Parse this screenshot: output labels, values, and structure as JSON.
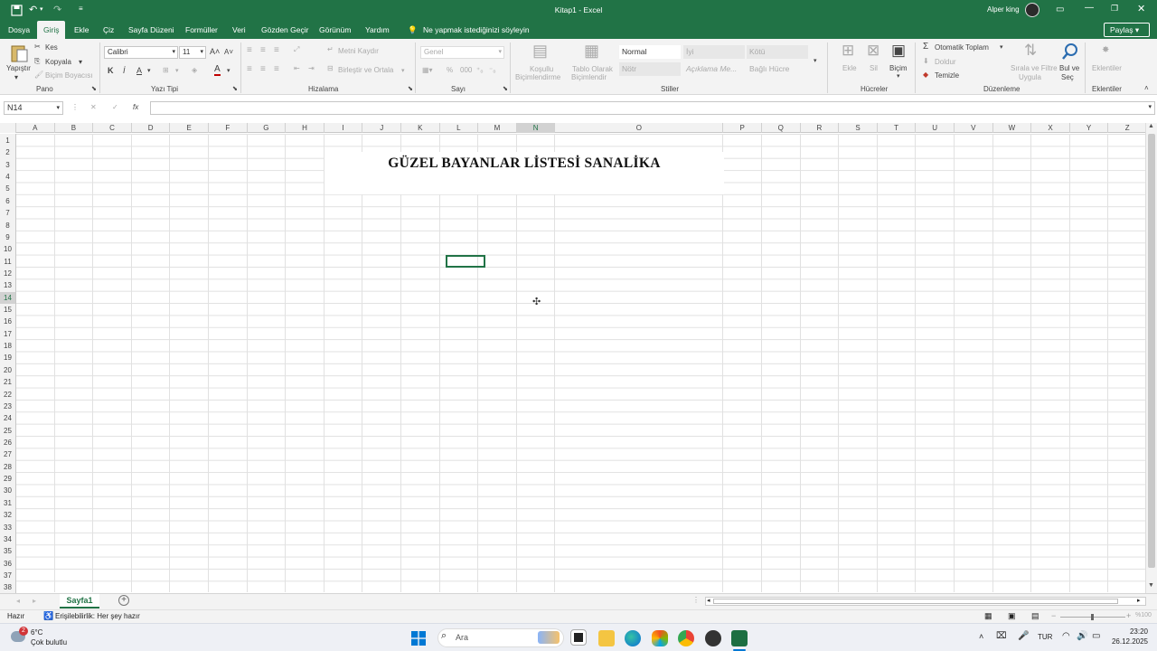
{
  "title_bar": {
    "doc_title": "Kitap1 - Excel",
    "user_name": "Alper king"
  },
  "ribbon_tabs": [
    "Dosya",
    "Giriş",
    "Ekle",
    "Çiz",
    "Sayfa Düzeni",
    "Formüller",
    "Veri",
    "Gözden Geçir",
    "Görünüm",
    "Yardım"
  ],
  "tell_me": "Ne yapmak istediğinizi söyleyin",
  "share_label": "Paylaş",
  "clipboard": {
    "paste": "Yapıştır",
    "cut": "Kes",
    "copy": "Kopyala",
    "format_painter": "Biçim Boyacısı",
    "group": "Pano"
  },
  "font": {
    "name": "Calibri",
    "size": "11",
    "bold": "K",
    "italic": "İ",
    "underline": "A",
    "color_btn": "A",
    "group": "Yazı Tipi"
  },
  "alignment": {
    "wrap": "Metni Kaydır",
    "merge": "Birleştir ve Ortala",
    "group": "Hizalama"
  },
  "number": {
    "format": "Genel",
    "percent": "%",
    "group": "Sayı"
  },
  "styles": {
    "conditional": [
      "Koşullu",
      "Biçimlendirme"
    ],
    "table": [
      "Tablo Olarak",
      "Biçimlendir"
    ],
    "cells": [
      "Normal",
      "İyi",
      "Kötü",
      "Nötr",
      "Açıklama Me...",
      "Bağlı Hücre"
    ],
    "group": "Stiller"
  },
  "cells_group": {
    "insert": "Ekle",
    "delete": "Sil",
    "format": "Biçim",
    "group": "Hücreler"
  },
  "editing": {
    "autosum": "Otomatik Toplam",
    "fill": "Doldur",
    "clear": "Temizle",
    "sort": [
      "Sırala ve Filtre",
      "Uygula"
    ],
    "find": [
      "Bul ve",
      "Seç"
    ],
    "group": "Düzenleme"
  },
  "addins": {
    "label": "Eklentiler",
    "group": "Eklentiler"
  },
  "formula_bar": {
    "name_box": "N14",
    "cancel": "✕",
    "enter": "✓",
    "fx": "fx",
    "value": ""
  },
  "columns": [
    "A",
    "B",
    "C",
    "D",
    "E",
    "F",
    "G",
    "H",
    "I",
    "J",
    "K",
    "L",
    "M",
    "N",
    "O",
    "P",
    "Q",
    "R",
    "S",
    "T",
    "U",
    "V",
    "W",
    "X",
    "Y",
    "Z"
  ],
  "rows": [
    "1",
    "2",
    "3",
    "4",
    "5",
    "6",
    "7",
    "8",
    "9",
    "10",
    "11",
    "12",
    "13",
    "14",
    "15",
    "16",
    "17",
    "18",
    "19",
    "20",
    "21",
    "22",
    "23",
    "24",
    "25",
    "26",
    "27",
    "28",
    "29",
    "30",
    "31",
    "32",
    "33",
    "34",
    "35",
    "36",
    "37",
    "38"
  ],
  "sheet_title": "GÜZEL BAYANLAR LİSTESİ SANALİKA",
  "sheet_tab": "Sayfa1",
  "status": {
    "ready": "Hazır",
    "accessibility": "Erişilebilirlik: Her şey hazır",
    "zoom": "%100"
  },
  "taskbar": {
    "weather_temp": "6°C",
    "weather_desc": "Çok bulutlu",
    "weather_badge": "2",
    "search": "Ara",
    "lang": "TUR",
    "time": "23:20",
    "date": "26.12.2025"
  },
  "colors": {
    "excel_green": "#217346",
    "ribbon_bg": "#f3f3f3",
    "grid_line": "#e1e1e1"
  }
}
